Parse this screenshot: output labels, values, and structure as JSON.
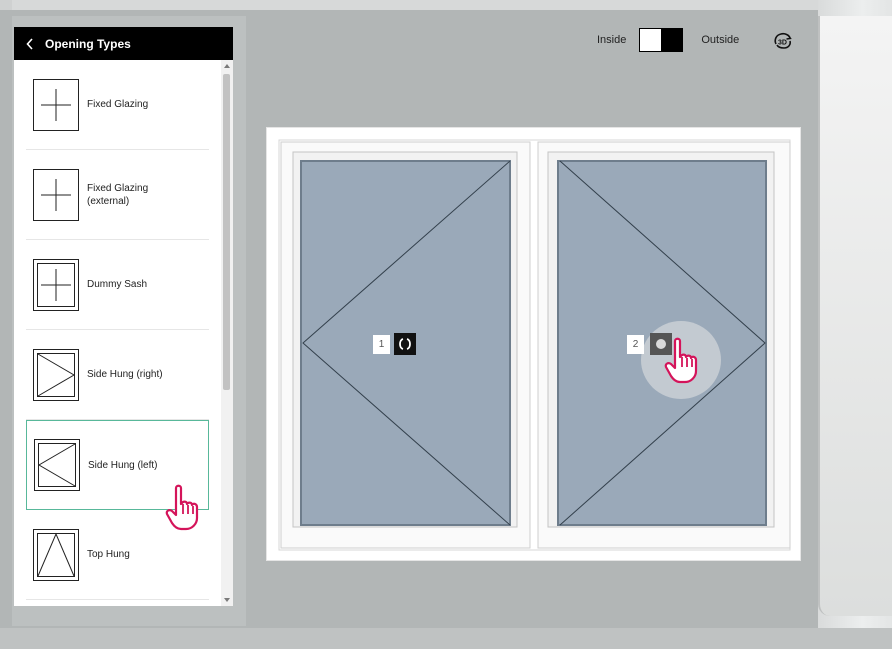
{
  "sidebar": {
    "title": "Opening Types",
    "items": [
      {
        "label": "Fixed Glazing",
        "icon": "fixed-glazing-icon"
      },
      {
        "label": "Fixed Glazing\n(external)",
        "icon": "fixed-glazing-external-icon"
      },
      {
        "label": "Dummy Sash",
        "icon": "dummy-sash-icon"
      },
      {
        "label": "Side Hung (right)",
        "icon": "side-hung-right-icon"
      },
      {
        "label": "Side Hung (left)",
        "icon": "side-hung-left-icon",
        "selected": true
      },
      {
        "label": "Top Hung",
        "icon": "top-hung-icon"
      }
    ]
  },
  "view_toggle": {
    "inside_label": "Inside",
    "outside_label": "Outside"
  },
  "toolbar": {
    "view_3d_label": "3D"
  },
  "window": {
    "sashes": [
      {
        "number": "1"
      },
      {
        "number": "2"
      }
    ]
  },
  "colors": {
    "glass": "#9aa9b9",
    "accent_selected": "#58b89a",
    "pointer": "#d4145a"
  }
}
